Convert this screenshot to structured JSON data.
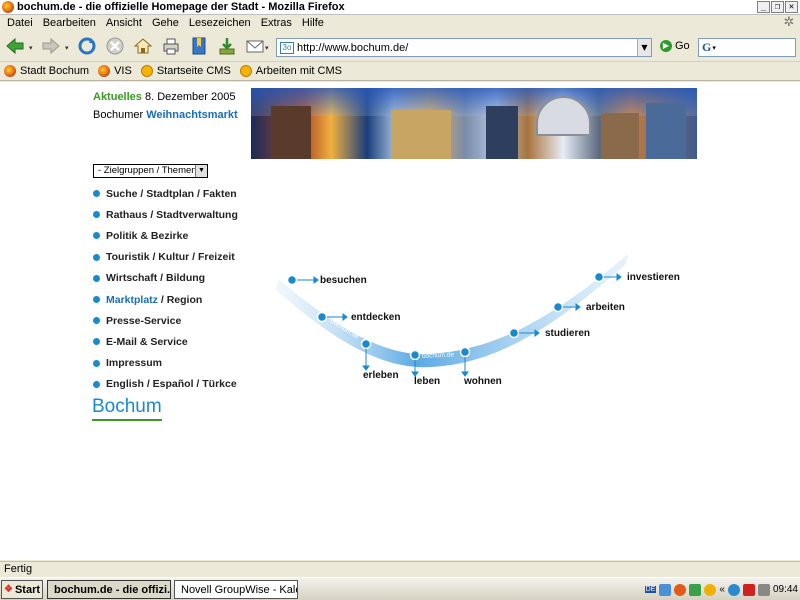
{
  "window": {
    "title": "bochum.de - die offizielle Homepage der Stadt - Mozilla Firefox",
    "controls": [
      "_",
      "❐",
      "✕"
    ]
  },
  "menubar": {
    "items": [
      "Datei",
      "Bearbeiten",
      "Ansicht",
      "Gehe",
      "Lesezeichen",
      "Extras",
      "Hilfe"
    ]
  },
  "navbar": {
    "url": "http://www.bochum.de/",
    "go_label": "Go",
    "search_placeholder": ""
  },
  "bookmarks": {
    "items": [
      "Stadt Bochum",
      "VIS",
      "Startseite CMS",
      "Arbeiten mit CMS"
    ]
  },
  "page": {
    "news_label": "Aktuelles",
    "news_date": "8. Dezember 2005",
    "news_prefix": "Bochumer",
    "news_link": "Weihnachtsmarkt",
    "select_value": "-  Zielgruppen / Themen",
    "nav_items": [
      "Suche / Stadtplan / Fakten",
      "Rathaus / Stadtverwaltung",
      "Politik & Bezirke",
      "Touristik / Kultur / Freizeit",
      "Wirtschaft / Bildung",
      "Marktplatz",
      "/ Region",
      "Presse-Service",
      "E-Mail & Service",
      "Impressum",
      "English / Español / Türkce"
    ],
    "logo": "Bochum",
    "graphic_labels": {
      "besuchen": "besuchen",
      "entdecken": "entdecken",
      "erleben": "erleben",
      "leben": "leben",
      "wohnen": "wohnen",
      "studieren": "studieren",
      "arbeiten": "arbeiten",
      "investieren": "investieren",
      "brand": "bochum.de"
    }
  },
  "statusbar": {
    "text": "Fertig"
  },
  "taskbar": {
    "start": "Start",
    "tasks": [
      "bochum.de - die offizi...",
      "Novell GroupWise - Kalen..."
    ],
    "clock": "09:44",
    "lang": "DE"
  }
}
